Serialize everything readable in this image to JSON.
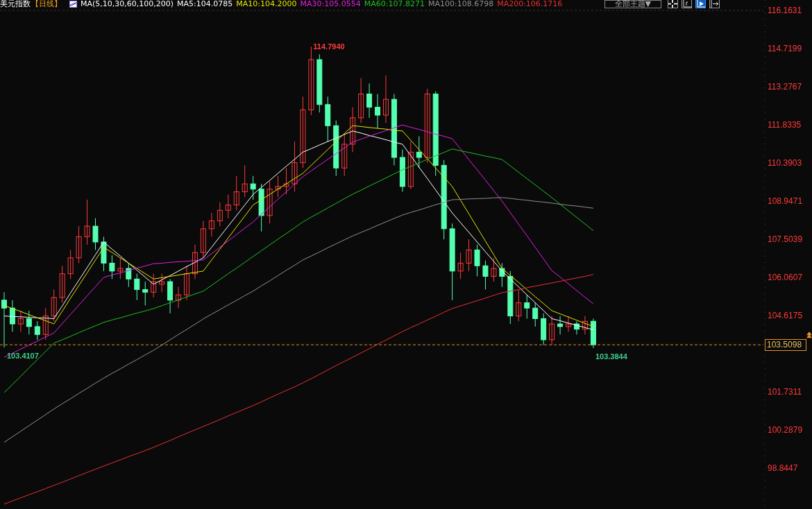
{
  "header": {
    "title": "美元指数",
    "period": "【日线】",
    "indicator": "MA(5,10,30,60,100,200)",
    "ma_values": [
      ":104.0785",
      ":104.2000",
      ":105.0554",
      ":107.8271",
      ":108.6798",
      ":106.1716"
    ],
    "theme_dropdown": "全部主题▼",
    "tools": [
      {
        "kind": "crosshair",
        "selected": false
      },
      {
        "kind": "axis",
        "selected": false
      },
      {
        "kind": "play",
        "selected": true
      },
      {
        "kind": "shift",
        "selected": false
      }
    ]
  },
  "chart_data": {
    "type": "candlestick",
    "ylim": [
      97.2967,
      116.5567
    ],
    "annotations": [
      "114.7940",
      "103.4107",
      "103.3844"
    ],
    "yticks": [
      116.1631,
      114.7199,
      113.2767,
      111.8335,
      110.3903,
      108.9471,
      107.5039,
      106.0607,
      104.6175,
      101.7311,
      100.2879,
      98.8447
    ],
    "ohlc": [
      [
        105.2,
        105.5,
        103.4107,
        104.9
      ],
      [
        104.9,
        105.2,
        104.0,
        104.3
      ],
      [
        104.3,
        104.8,
        104.0,
        104.5
      ],
      [
        104.5,
        104.8,
        103.9,
        104.2
      ],
      [
        104.2,
        104.4,
        103.7,
        103.9
      ],
      [
        103.9,
        104.9,
        103.7,
        104.6
      ],
      [
        104.6,
        105.6,
        104.4,
        105.3
      ],
      [
        105.3,
        106.5,
        105.1,
        106.2
      ],
      [
        106.2,
        107.1,
        106.0,
        106.8
      ],
      [
        106.8,
        108.0,
        106.6,
        107.6
      ],
      [
        107.6,
        109.0,
        107.3,
        108.0
      ],
      [
        108.0,
        108.3,
        107.1,
        107.4
      ],
      [
        107.4,
        107.6,
        106.3,
        106.6
      ],
      [
        106.6,
        106.9,
        106.0,
        106.3
      ],
      [
        106.3,
        106.8,
        106.0,
        106.4
      ],
      [
        106.4,
        106.6,
        105.7,
        106.0
      ],
      [
        106.0,
        106.2,
        105.2,
        105.6
      ],
      [
        105.6,
        105.9,
        105.0,
        105.5
      ],
      [
        105.5,
        106.2,
        105.3,
        105.9
      ],
      [
        105.8,
        106.2,
        105.5,
        105.9
      ],
      [
        105.9,
        106.0,
        104.7,
        105.2
      ],
      [
        105.2,
        105.7,
        104.9,
        105.4
      ],
      [
        105.4,
        106.5,
        105.2,
        106.2
      ],
      [
        106.2,
        107.3,
        106.0,
        107.0
      ],
      [
        107.0,
        108.2,
        106.8,
        107.9
      ],
      [
        107.9,
        108.5,
        107.6,
        108.2
      ],
      [
        108.2,
        108.9,
        108.0,
        108.6
      ],
      [
        108.6,
        109.2,
        108.3,
        108.8
      ],
      [
        108.8,
        109.9,
        108.6,
        109.3
      ],
      [
        109.3,
        110.3,
        109.1,
        109.6
      ],
      [
        109.6,
        109.9,
        109.0,
        109.4
      ],
      [
        109.4,
        109.6,
        107.8,
        108.4
      ],
      [
        108.4,
        109.7,
        108.1,
        109.4
      ],
      [
        109.4,
        109.9,
        109.1,
        109.5
      ],
      [
        109.5,
        110.2,
        109.2,
        109.6
      ],
      [
        109.6,
        111.2,
        109.3,
        110.4
      ],
      [
        110.4,
        112.9,
        110.2,
        112.4
      ],
      [
        112.4,
        114.794,
        112.2,
        114.3
      ],
      [
        114.3,
        114.5,
        112.3,
        112.6
      ],
      [
        112.6,
        112.9,
        111.2,
        111.8
      ],
      [
        111.8,
        112.0,
        109.9,
        110.2
      ],
      [
        110.2,
        111.5,
        109.9,
        111.1
      ],
      [
        111.1,
        112.5,
        110.8,
        112.1
      ],
      [
        112.1,
        113.6,
        111.9,
        113.0
      ],
      [
        113.0,
        113.4,
        112.1,
        112.5
      ],
      [
        112.5,
        113.0,
        111.7,
        112.2
      ],
      [
        112.2,
        113.7,
        111.9,
        112.8
      ],
      [
        112.8,
        113.0,
        110.3,
        110.6
      ],
      [
        110.6,
        110.9,
        109.3,
        109.5
      ],
      [
        109.5,
        111.2,
        109.4,
        110.8
      ],
      [
        110.8,
        111.4,
        110.2,
        110.6
      ],
      [
        110.6,
        113.2,
        110.4,
        113.0
      ],
      [
        113.0,
        113.1,
        109.9,
        110.3
      ],
      [
        110.3,
        110.5,
        107.5,
        107.9
      ],
      [
        107.9,
        108.1,
        105.2,
        106.3
      ],
      [
        106.3,
        107.0,
        106.0,
        106.6
      ],
      [
        106.6,
        107.5,
        106.3,
        107.1
      ],
      [
        107.1,
        107.3,
        106.1,
        106.5
      ],
      [
        106.5,
        106.7,
        105.6,
        106.1
      ],
      [
        106.1,
        106.8,
        105.9,
        106.4
      ],
      [
        106.4,
        106.6,
        105.7,
        106.1
      ],
      [
        106.1,
        106.3,
        104.3,
        104.6
      ],
      [
        104.6,
        105.6,
        104.4,
        105.1
      ],
      [
        105.1,
        105.4,
        104.5,
        104.9
      ],
      [
        104.9,
        105.1,
        104.2,
        104.5
      ],
      [
        104.5,
        104.7,
        103.5,
        103.7
      ],
      [
        103.7,
        104.6,
        103.5,
        104.3
      ],
      [
        104.3,
        104.6,
        103.9,
        104.2
      ],
      [
        104.2,
        104.6,
        104.0,
        104.3
      ],
      [
        104.3,
        104.4,
        103.9,
        104.1
      ],
      [
        104.1,
        104.6,
        103.9,
        104.4
      ],
      [
        104.4,
        104.5,
        103.3844,
        103.5098
      ],
      null,
      null,
      null,
      null,
      null,
      null,
      null,
      null,
      null,
      null,
      null,
      null,
      null,
      null,
      null,
      null,
      null,
      null,
      null,
      null
    ],
    "series": [
      {
        "name": "MA5",
        "type": "line",
        "color": "#ffffff",
        "values": [
          104.6,
          104.58,
          104.57,
          104.55,
          104.53,
          104.52,
          104.5,
          104.98,
          105.47,
          105.95,
          106.43,
          106.92,
          107.4,
          107.13,
          106.87,
          106.6,
          106.33,
          106.07,
          105.8,
          105.97,
          106.13,
          106.3,
          106.47,
          106.63,
          106.8,
          107.2,
          107.6,
          108.0,
          108.4,
          108.8,
          109.2,
          109.47,
          109.73,
          110.0,
          110.27,
          110.53,
          110.8,
          110.93,
          111.07,
          111.2,
          111.33,
          111.47,
          111.6,
          111.52,
          111.43,
          111.35,
          111.27,
          111.18,
          111.1,
          110.67,
          110.23,
          109.8,
          109.37,
          108.93,
          108.5,
          108.13,
          107.77,
          107.4,
          107.03,
          106.67,
          106.3,
          106.0,
          105.7,
          105.4,
          105.1,
          104.8,
          104.5,
          104.42,
          104.33,
          104.25,
          104.16,
          104.08,
          null,
          null,
          null,
          null,
          null,
          null,
          null,
          null,
          null,
          null,
          null,
          null,
          null,
          null,
          null,
          null,
          null,
          null,
          null,
          null
        ]
      },
      {
        "name": "MA10",
        "type": "line",
        "color": "#e6e600",
        "values": [
          105.0,
          104.88,
          104.77,
          104.65,
          104.53,
          104.42,
          104.3,
          104.78,
          105.27,
          105.75,
          106.23,
          106.72,
          107.2,
          107.0,
          106.8,
          106.6,
          106.4,
          106.2,
          106.0,
          106.05,
          106.1,
          106.15,
          106.2,
          106.25,
          106.3,
          106.72,
          107.13,
          107.55,
          107.97,
          108.38,
          108.8,
          109.0,
          109.2,
          109.4,
          109.6,
          109.8,
          110.0,
          110.3,
          110.6,
          110.9,
          111.2,
          111.5,
          111.8,
          111.77,
          111.73,
          111.7,
          111.67,
          111.63,
          111.6,
          111.25,
          110.9,
          110.55,
          110.2,
          109.85,
          109.5,
          108.98,
          108.47,
          107.95,
          107.43,
          106.92,
          106.4,
          106.13,
          105.87,
          105.6,
          105.33,
          105.07,
          104.8,
          104.68,
          104.56,
          104.44,
          104.32,
          104.2,
          null,
          null,
          null,
          null,
          null,
          null,
          null,
          null,
          null,
          null,
          null,
          null,
          null,
          null,
          null,
          null,
          null,
          null,
          null,
          null
        ]
      },
      {
        "name": "MA30",
        "type": "line",
        "color": "#e020e0",
        "values": [
          103.04,
          103.19,
          103.35,
          103.5,
          103.65,
          103.81,
          103.96,
          104.31,
          104.66,
          105.01,
          105.36,
          105.71,
          106.06,
          106.15,
          106.23,
          106.32,
          106.41,
          106.49,
          106.58,
          106.6,
          106.63,
          106.65,
          106.67,
          106.7,
          106.72,
          106.96,
          107.2,
          107.44,
          107.68,
          107.92,
          108.16,
          108.45,
          108.73,
          109.02,
          109.3,
          109.59,
          109.87,
          110.09,
          110.31,
          110.53,
          110.74,
          110.96,
          111.18,
          111.29,
          111.4,
          111.51,
          111.61,
          111.72,
          111.83,
          111.74,
          111.66,
          111.57,
          111.48,
          111.4,
          111.31,
          110.92,
          110.52,
          110.13,
          109.74,
          109.34,
          108.95,
          108.51,
          108.07,
          107.64,
          107.2,
          106.76,
          106.32,
          106.07,
          105.82,
          105.56,
          105.31,
          105.06,
          null,
          null,
          null,
          null,
          null,
          null,
          null,
          null,
          null,
          null,
          null,
          null,
          null,
          null,
          null,
          null,
          null,
          null,
          null,
          null
        ]
      },
      {
        "name": "MA60",
        "type": "line",
        "color": "#20c020",
        "values": [
          101.7,
          102.01,
          102.32,
          102.64,
          102.95,
          103.26,
          103.57,
          103.7,
          103.83,
          103.97,
          104.1,
          104.23,
          104.36,
          104.45,
          104.53,
          104.62,
          104.71,
          104.79,
          104.88,
          104.99,
          105.1,
          105.21,
          105.32,
          105.43,
          105.54,
          105.76,
          105.98,
          106.2,
          106.41,
          106.63,
          106.85,
          107.07,
          107.29,
          107.51,
          107.72,
          107.94,
          108.16,
          108.34,
          108.51,
          108.69,
          108.86,
          109.04,
          109.21,
          109.36,
          109.52,
          109.67,
          109.82,
          109.98,
          110.13,
          110.26,
          110.39,
          110.53,
          110.66,
          110.79,
          110.92,
          110.85,
          110.79,
          110.72,
          110.65,
          110.59,
          110.52,
          110.28,
          110.04,
          109.8,
          109.56,
          109.32,
          109.08,
          108.83,
          108.58,
          108.33,
          108.08,
          107.83,
          null,
          null,
          null,
          null,
          null,
          null,
          null,
          null,
          null,
          null,
          null,
          null,
          null,
          null,
          null,
          null,
          null,
          null,
          null,
          null
        ]
      },
      {
        "name": "MA100",
        "type": "line",
        "color": "#909090",
        "values": [
          99.82,
          100.03,
          100.24,
          100.45,
          100.66,
          100.87,
          101.08,
          101.28,
          101.47,
          101.67,
          101.86,
          102.06,
          102.25,
          102.43,
          102.6,
          102.78,
          102.95,
          103.13,
          103.3,
          103.5,
          103.7,
          103.9,
          104.09,
          104.29,
          104.49,
          104.67,
          104.84,
          105.02,
          105.19,
          105.37,
          105.54,
          105.74,
          105.93,
          106.13,
          106.33,
          106.52,
          106.72,
          106.87,
          107.02,
          107.18,
          107.33,
          107.48,
          107.63,
          107.76,
          107.89,
          108.03,
          108.16,
          108.29,
          108.42,
          108.52,
          108.61,
          108.71,
          108.81,
          108.9,
          109.0,
          109.01,
          109.03,
          109.04,
          109.05,
          109.07,
          109.08,
          109.05,
          109.01,
          108.98,
          108.94,
          108.91,
          108.87,
          108.83,
          108.79,
          108.76,
          108.72,
          108.68,
          null,
          null,
          null,
          null,
          null,
          null,
          null,
          null,
          null,
          null,
          null,
          null,
          null,
          null,
          null,
          null,
          null,
          null,
          null,
          null
        ]
      },
      {
        "name": "MA200",
        "type": "line",
        "color": "#e83030",
        "values": [
          97.48,
          97.6,
          97.72,
          97.84,
          97.95,
          98.07,
          98.19,
          98.31,
          98.43,
          98.56,
          98.68,
          98.8,
          98.92,
          99.04,
          99.16,
          99.28,
          99.39,
          99.51,
          99.63,
          99.76,
          99.89,
          100.03,
          100.16,
          100.29,
          100.42,
          100.55,
          100.68,
          100.82,
          100.95,
          101.08,
          101.21,
          101.35,
          101.5,
          101.64,
          101.78,
          101.92,
          102.07,
          102.23,
          102.39,
          102.56,
          102.72,
          102.88,
          103.04,
          103.2,
          103.36,
          103.53,
          103.69,
          103.85,
          104.01,
          104.16,
          104.3,
          104.45,
          104.59,
          104.74,
          104.88,
          104.98,
          105.08,
          105.18,
          105.28,
          105.38,
          105.48,
          105.54,
          105.6,
          105.67,
          105.73,
          105.79,
          105.85,
          105.91,
          105.98,
          106.04,
          106.1,
          106.17,
          null,
          null,
          null,
          null,
          null,
          null,
          null,
          null,
          null,
          null,
          null,
          null,
          null,
          null,
          null,
          null,
          null,
          null,
          null,
          null
        ]
      }
    ],
    "ref_lines": [
      {
        "axis": "y",
        "value": 103.5098,
        "label": "103.5098"
      }
    ]
  }
}
